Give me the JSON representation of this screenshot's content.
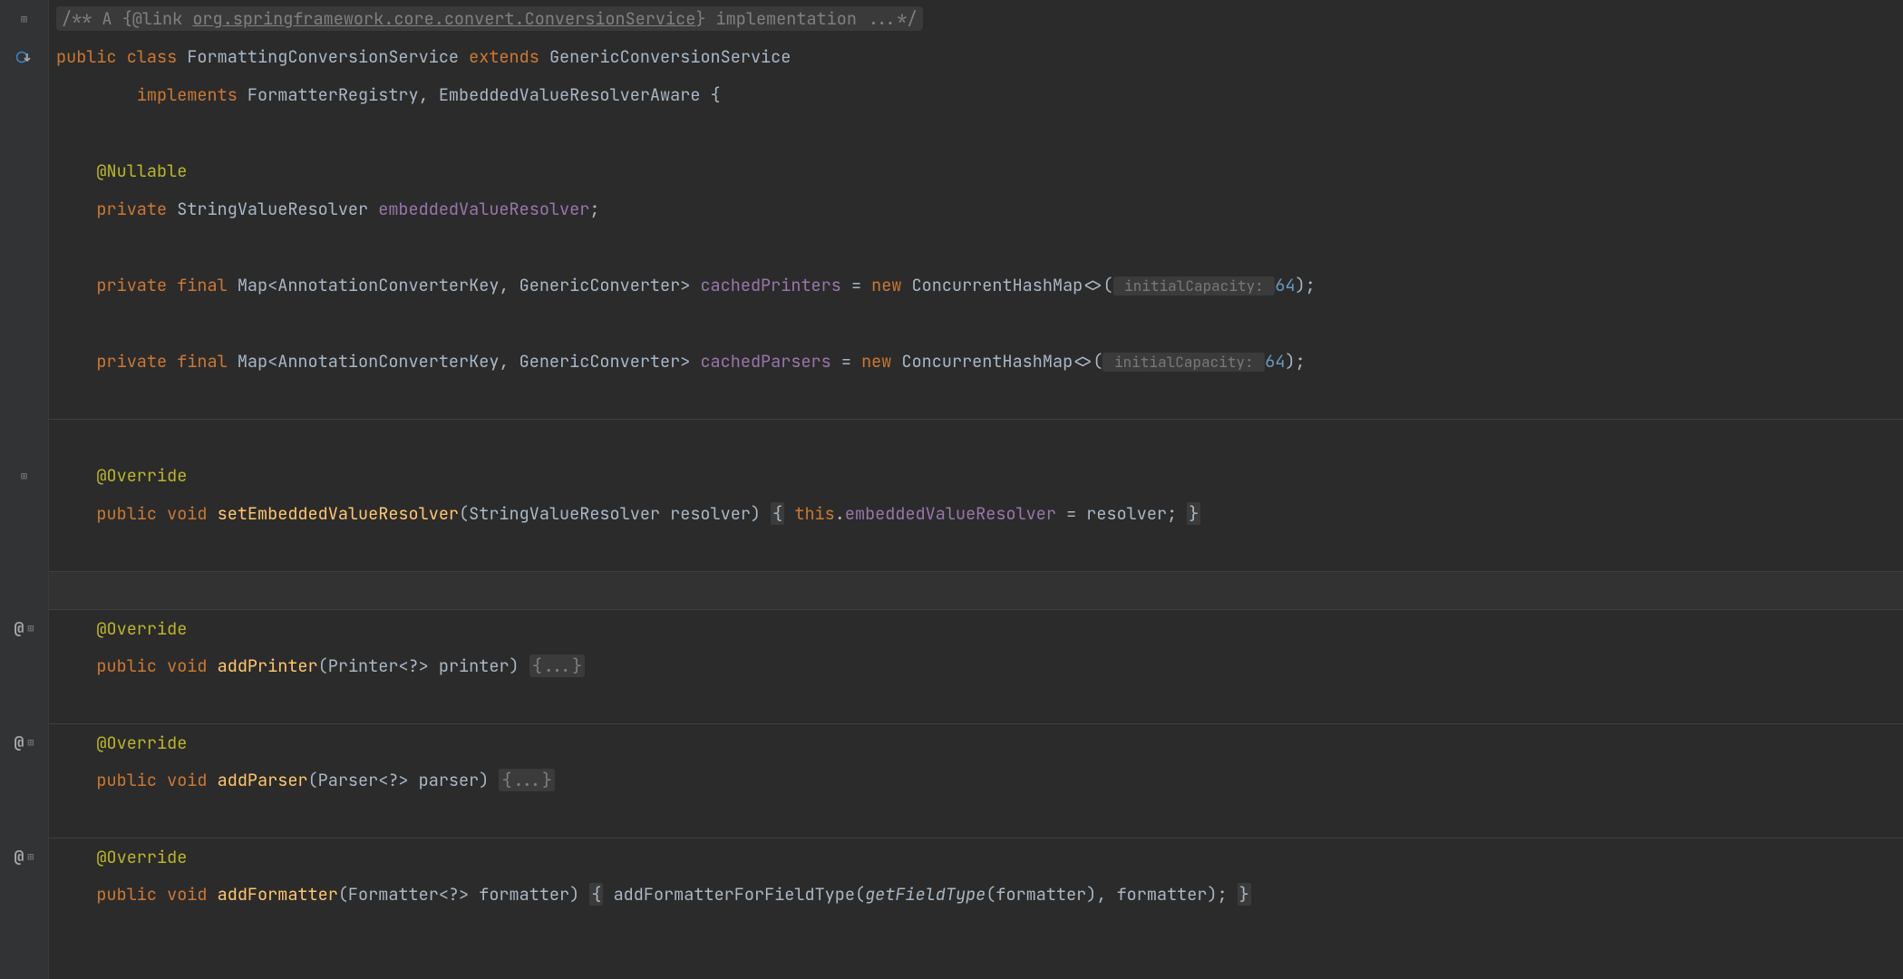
{
  "comment": {
    "start": "/** ",
    "text1": "A ",
    "linktag": "{@link ",
    "linktarget": "org.springframework.core.convert.ConversionService",
    "linkclose": "}",
    "text2": " implementation ",
    "ellipsis": "...",
    "end": "*/"
  },
  "class_decl": {
    "kw_public": "public ",
    "kw_class": "class ",
    "name": "FormattingConversionService ",
    "kw_extends": "extends ",
    "super": "GenericConversionService",
    "indent": "        ",
    "kw_implements": "implements ",
    "iface1": "FormatterRegistry",
    "comma": ", ",
    "iface2": "EmbeddedValueResolverAware ",
    "brace": "{"
  },
  "field1": {
    "indent": "    ",
    "ann": "@Nullable",
    "kw_private": "private ",
    "type": "StringValueResolver ",
    "name": "embeddedValueResolver",
    "semi": ";"
  },
  "field2": {
    "indent": "    ",
    "kw_private": "private ",
    "kw_final": "final ",
    "type_pre": "Map<AnnotationConverterKey, GenericConverter> ",
    "name": "cachedPrinters",
    "eq": " = ",
    "kw_new": "new ",
    "ctor": "ConcurrentHashMap<>(",
    "hint_label": " initialCapacity: ",
    "arg": "64",
    "close": ");"
  },
  "field3": {
    "indent": "    ",
    "kw_private": "private ",
    "kw_final": "final ",
    "type_pre": "Map<AnnotationConverterKey, GenericConverter> ",
    "name": "cachedParsers",
    "eq": " = ",
    "kw_new": "new ",
    "ctor": "ConcurrentHashMap<>(",
    "hint_label": " initialCapacity: ",
    "arg": "64",
    "close": ");"
  },
  "method1": {
    "indent": "    ",
    "ann": "@Override",
    "kw_public": "public ",
    "kw_void": "void ",
    "name": "setEmbeddedValueResolver",
    "params": "(StringValueResolver resolver) ",
    "brace_open": "{",
    "sp": " ",
    "kw_this": "this",
    "dot": ".",
    "field": "embeddedValueResolver",
    "eq": " = resolver",
    "semi": "; ",
    "brace_close": "}"
  },
  "method2": {
    "indent": "    ",
    "ann": "@Override",
    "kw_public": "public ",
    "kw_void": "void ",
    "name": "addPrinter",
    "params": "(Printer<?> printer) ",
    "folded": "{...}"
  },
  "method3": {
    "indent": "    ",
    "ann": "@Override",
    "kw_public": "public ",
    "kw_void": "void ",
    "name": "addParser",
    "params": "(Parser<?> parser) ",
    "folded": "{...}"
  },
  "method4": {
    "indent": "    ",
    "ann": "@Override",
    "kw_public": "public ",
    "kw_void": "void ",
    "name": "addFormatter",
    "params": "(Formatter<?> formatter) ",
    "brace_open": "{",
    "sp": " ",
    "call1": "addFormatterForFieldType(",
    "call2": "getFieldType",
    "args": "(formatter), formatter)",
    "semi": "; ",
    "brace_close": "}"
  },
  "gutter": {
    "expand": "⊞",
    "impl_svg_color": "#3b85c6",
    "override_at": "@"
  }
}
